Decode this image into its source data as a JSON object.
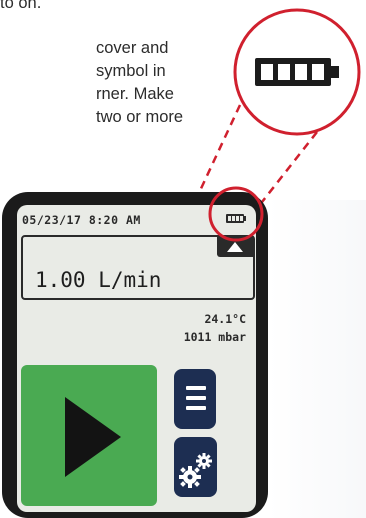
{
  "manual": {
    "lines": [
      "to on.",
      "cover and",
      "symbol in",
      "rner. Make",
      "two or more"
    ]
  },
  "callout": {
    "icon": "battery-full-icon",
    "circle_color": "#d0202e"
  },
  "device_screen": {
    "status_date": "05/23/17",
    "status_time": "8:20",
    "status_ampm": "AM",
    "battery_icon": "battery-full-icon",
    "flow_value": "1.00",
    "flow_unit": "L/min",
    "flow_adjust_icon": "triangle-up-icon",
    "temperature": "24.1°C",
    "pressure": "1011 mbar",
    "play_icon": "play-icon",
    "menu_icon": "hamburger-menu-icon",
    "settings_icon": "gears-icon"
  },
  "colors": {
    "screen_bg": "#e9ebe6",
    "play_button": "#4aaa52",
    "nav_button": "#1d2e52",
    "device_body": "#1b1b1b"
  }
}
